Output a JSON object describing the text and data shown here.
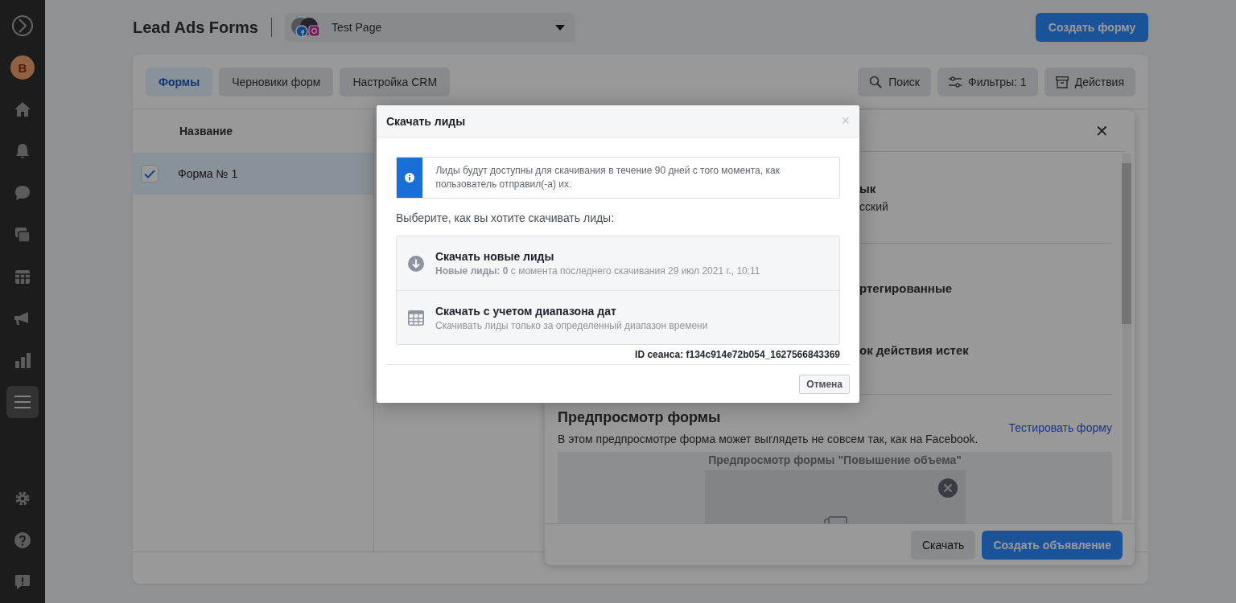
{
  "sidebar": {
    "items": [
      {
        "kind": "logo",
        "selected": false
      },
      {
        "kind": "avatar",
        "label": "B",
        "selected": false
      },
      {
        "kind": "home",
        "selected": false
      },
      {
        "kind": "bell",
        "selected": false
      },
      {
        "kind": "chat",
        "selected": false
      },
      {
        "kind": "pages",
        "selected": false
      },
      {
        "kind": "calendar",
        "selected": false
      },
      {
        "kind": "megaphone",
        "selected": false
      },
      {
        "kind": "chart",
        "selected": false
      },
      {
        "kind": "menu",
        "selected": true
      }
    ],
    "bottom_items": [
      {
        "kind": "gear"
      },
      {
        "kind": "help"
      },
      {
        "kind": "report"
      }
    ]
  },
  "header": {
    "title": "Lead Ads Forms",
    "page_selector": {
      "value": "Test Page"
    },
    "create_button": "Создать форму"
  },
  "tabs": [
    {
      "label": "Формы",
      "selected": true
    },
    {
      "label": "Черновики форм",
      "selected": false
    },
    {
      "label": "Настройка CRM",
      "selected": false
    }
  ],
  "toolbar": [
    {
      "kind": "search",
      "label": "Поиск"
    },
    {
      "kind": "filter",
      "label": "Фильтры: 1"
    },
    {
      "kind": "archive",
      "label": "Действия"
    }
  ],
  "table": {
    "columns": [
      "Название"
    ],
    "rows": [
      {
        "name": "Форма № 1",
        "checked": true,
        "selected": true
      }
    ]
  },
  "detail_panel": {
    "close": "✕",
    "sections": [
      {
        "lines": [
          {
            "text": "ык",
            "bold": true
          },
          {
            "text": "сский",
            "bold": false
          }
        ]
      },
      {
        "lines": [
          {
            "text": "ртегированные",
            "bold": true
          },
          {
            "text": "ок действия истек",
            "bold": true
          }
        ]
      }
    ],
    "preview": {
      "title": "Предпросмотр формы",
      "link": "Тестировать форму",
      "description": "В этом предпросмотре форма может выглядеть не совсем так, как на Facebook.",
      "frame_title": "Предпросмотр формы \"Повышение объема\""
    },
    "footer_buttons": [
      {
        "kind": "secondary",
        "label": "Скачать"
      },
      {
        "kind": "primary",
        "label": "Создать объявление"
      }
    ]
  },
  "modal": {
    "title": "Скачать лиды",
    "close": "×",
    "notice": "Лиды будут доступны для скачивания в течение 90 дней с того момента, как пользователь отправил(-а) их.",
    "prompt": "Выберите, как вы хотите скачивать лиды:",
    "options": [
      {
        "kind": "download",
        "title": "Скачать новые лиды",
        "subtitle": "**Новые лиды: 0** с момента последнего скачивания 29 июл 2021 г., 10:11"
      },
      {
        "kind": "calendar",
        "title": "Скачать с учетом диапазона дат",
        "subtitle": "Скачивать лиды только за определенный диапазон времени"
      }
    ],
    "session_id": "ID сеанса: f134c914e72b054_1627566843369",
    "cancel": "Отмена"
  }
}
